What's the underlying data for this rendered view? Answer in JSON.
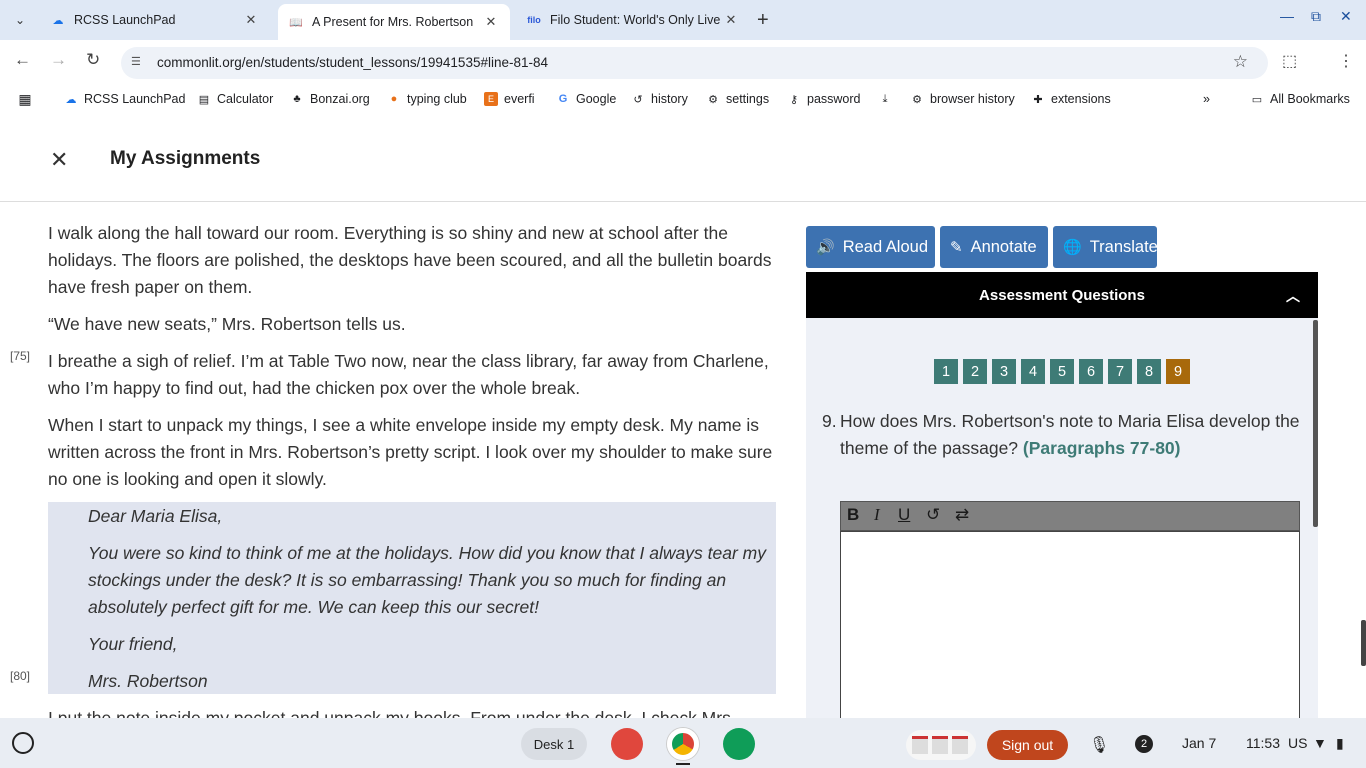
{
  "browser": {
    "tabs": [
      {
        "title": "RCSS LaunchPad",
        "active": false
      },
      {
        "title": "A Present for Mrs. Robertson",
        "active": true
      },
      {
        "title": "Filo Student: World's Only Live I",
        "active": false
      }
    ],
    "url": "commonlit.org/en/students/student_lessons/19941535#line-81-84",
    "bookmarks": [
      "RCSS LaunchPad",
      "Calculator",
      "Bonzai.org",
      "typing club",
      "everfi",
      "Google",
      "history",
      "settings",
      "password",
      "browser history",
      "extensions"
    ],
    "all_bookmarks": "All Bookmarks"
  },
  "header": {
    "title": "My Assignments"
  },
  "passage": {
    "paragraphs": [
      "I walk along the hall toward our room. Everything is so shiny and new at school after the holidays. The floors are polished, the desktops have been scoured, and all the bulletin boards have fresh paper on them.",
      "“We have new seats,” Mrs. Robertson tells us.",
      "I breathe a sigh of relief. I’m at Table Two now, near the class library, far away from Charlene, who I’m happy to find out, had the chicken pox over the whole break.",
      "When I start to unpack my things, I see a white envelope inside my empty desk. My name is written across the front in Mrs. Robertson’s pretty script. I look over my shoulder to make sure no one is looking and open it slowly.",
      "I put the note inside my pocket and unpack my books. From under the desk, I check Mrs."
    ],
    "letter": [
      "Dear Maria Elisa,",
      "You were so kind to think of me at the holidays. How did you know that I always tear my stockings under the desk? It is so embarrassing! Thank you so much for finding an absolutely perfect gift for me. We can keep this our secret!",
      "Your friend,",
      "Mrs. Robertson"
    ],
    "line_numbers": [
      "[75]",
      "[80]"
    ]
  },
  "tools": {
    "read_aloud": "Read Aloud",
    "annotate": "Annotate",
    "translate": "Translate"
  },
  "assessment": {
    "header": "Assessment Questions",
    "question_numbers": [
      "1",
      "2",
      "3",
      "4",
      "5",
      "6",
      "7",
      "8",
      "9"
    ],
    "active_question": "9",
    "question_index": "9.",
    "question_text": "How does Mrs. Robertson's note to Maria Elisa develop the theme of the passage?",
    "question_ref": "(Paragraphs 77-80)"
  },
  "shelf": {
    "desk": "Desk 1",
    "sign_out": "Sign out",
    "notifications": "2",
    "date": "Jan 7",
    "time": "11:53",
    "locale": "US"
  }
}
